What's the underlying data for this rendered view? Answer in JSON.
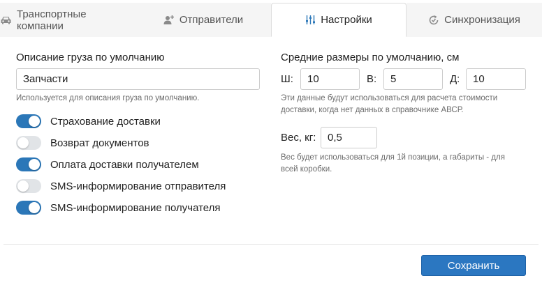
{
  "tabs": {
    "companies": {
      "label": "Транспортные компании",
      "icon": "car-icon"
    },
    "senders": {
      "label": "Отправители",
      "icon": "user-add-icon"
    },
    "settings": {
      "label": "Настройки",
      "icon": "sliders-icon"
    },
    "sync": {
      "label": "Синхронизация",
      "icon": "sync-icon"
    },
    "active": "settings"
  },
  "cargo": {
    "title": "Описание груза по умолчанию",
    "value": "Запчасти",
    "hint": "Используется для описания груза по умолчанию."
  },
  "toggles": [
    {
      "label": "Страхование доставки",
      "on": true
    },
    {
      "label": "Возврат документов",
      "on": false
    },
    {
      "label": "Оплата доставки получателем",
      "on": true
    },
    {
      "label": "SMS-информирование отправителя",
      "on": false
    },
    {
      "label": "SMS-информирование получателя",
      "on": true
    }
  ],
  "dimensions": {
    "title": "Средние размеры по умолчанию, см",
    "width_label": "Ш:",
    "width_value": "10",
    "height_label": "В:",
    "height_value": "5",
    "length_label": "Д:",
    "length_value": "10",
    "hint_line1": "Эти данные будут использоваться для расчета стоимости",
    "hint_line2": "доставки, когда нет данных в справочнике АВСР."
  },
  "weight": {
    "label": "Вес, кг:",
    "value": "0,5",
    "hint_line1": "Вес будет использоваться для 1й позиции, а габариты - для",
    "hint_line2": "всей коробки."
  },
  "actions": {
    "save_label": "Сохранить"
  },
  "colors": {
    "accent": "#2b77b8",
    "button": "#2b77c1",
    "toggle_off": "#e1e4e7"
  }
}
